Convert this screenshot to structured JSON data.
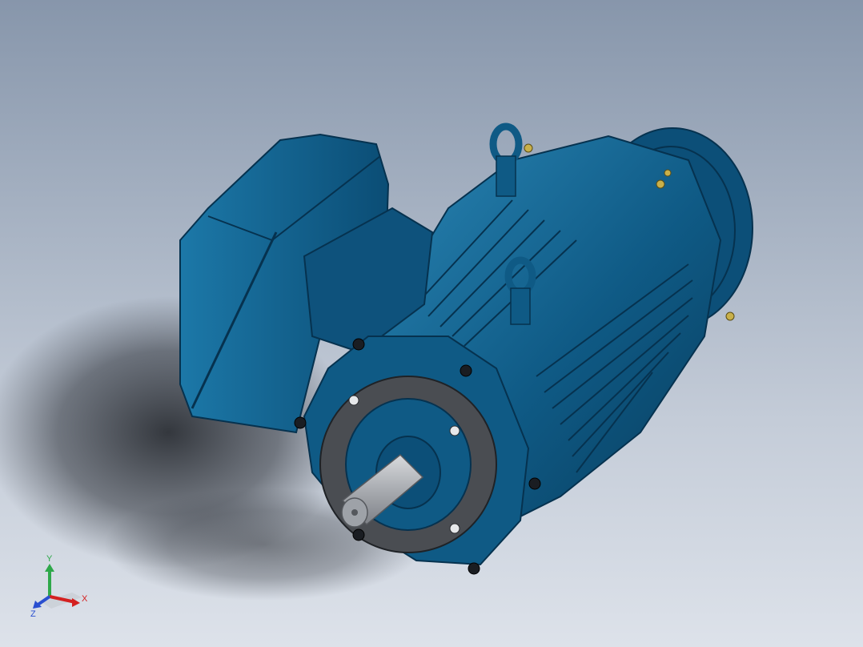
{
  "viewport": {
    "background_top": "#8796ab",
    "background_bottom": "#dde2ea"
  },
  "model": {
    "body_color": "#0f5a85",
    "body_dark": "#06324f",
    "body_light": "#2a86b5",
    "flange_color": "#4a4d52",
    "shaft_color": "#b9bcc1",
    "bolt_color": "#c8b04a"
  },
  "triad": {
    "x_label": "X",
    "y_label": "Y",
    "z_label": "Z",
    "x_color": "#d42020",
    "y_color": "#2ea84a",
    "z_color": "#2a4fd0"
  }
}
